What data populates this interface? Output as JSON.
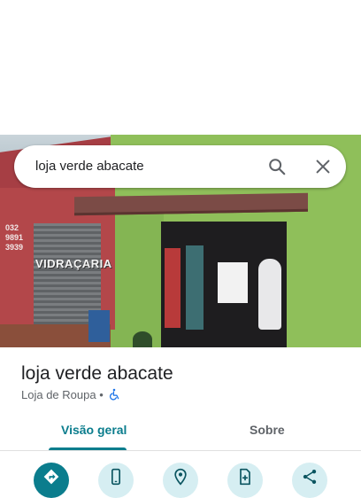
{
  "search": {
    "query": "loja verde abacate"
  },
  "place": {
    "name": "loja verde abacate",
    "category": "Loja de Roupa",
    "separator": "•"
  },
  "photo": {
    "shutter_sign": "VIDRAÇARIA",
    "wall_sign_text": "032 9891 3939"
  },
  "tabs": [
    {
      "label": "Visão geral",
      "active": true
    },
    {
      "label": "Sobre",
      "active": false
    }
  ],
  "actions": [
    {
      "icon": "directions-icon"
    },
    {
      "icon": "phone-icon"
    },
    {
      "icon": "location-pin-icon"
    },
    {
      "icon": "add-document-icon"
    },
    {
      "icon": "share-icon"
    }
  ],
  "colors": {
    "accent": "#0b7d8d",
    "action_bg": "#d6eef2"
  }
}
